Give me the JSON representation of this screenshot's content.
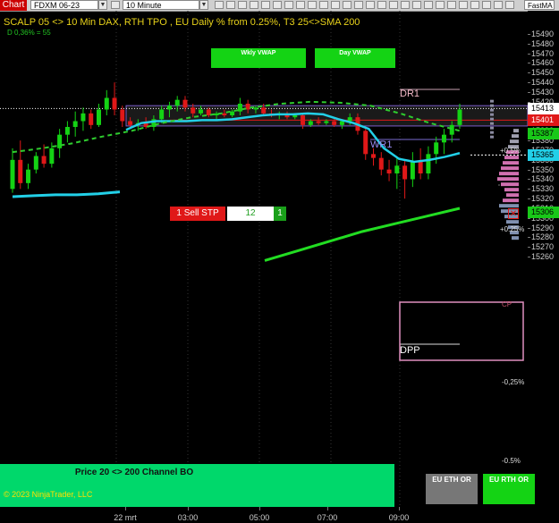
{
  "toolbar": {
    "chart_label": "Chart",
    "instrument": "FDXM 06-23",
    "interval": "10 Minute",
    "fast_ma": "FastMA",
    "highlight": "6 VWAP"
  },
  "chart_title": "SCALP 05 <> 10 Min DAX, RTH TPO , EU Daily % from 0.25%, T3 25<>SMA 200",
  "subtitle": "D 0,36% = 55",
  "buttons": {
    "wkly_vwap": "Wkly VWAP",
    "day_vwap": "Day VWAP",
    "eu_eth_or": "EU ETH OR",
    "eu_rth_or": "EU RTH OR"
  },
  "levels": {
    "dr1": "DR1",
    "wr1": "WR1",
    "dpp": "DPP",
    "cp": "CP"
  },
  "percent_labels": {
    "p1": "+0.5%",
    "p2": "+0.25%",
    "m1": "-0,25%",
    "m2": "-0.5%"
  },
  "order": {
    "label": "1 Sell STP",
    "quantity": "12",
    "size": "1"
  },
  "price_axis": {
    "ticks": [
      "15490",
      "15480",
      "15470",
      "15460",
      "15450",
      "15440",
      "15430",
      "15420",
      "15410",
      "15400",
      "15390",
      "15380",
      "15370",
      "15360",
      "15350",
      "15340",
      "15330",
      "15320",
      "15310",
      "15300",
      "15290",
      "15280",
      "15270",
      "15260"
    ],
    "tags": [
      {
        "value": "15413",
        "bg": "#ffffff",
        "fg": "#000000"
      },
      {
        "value": "15401",
        "bg": "#e01818",
        "fg": "#ffffff"
      },
      {
        "value": "15387",
        "bg": "#18c818",
        "fg": "#000000"
      },
      {
        "value": "15365",
        "bg": "#22d0e8",
        "fg": "#000000"
      },
      {
        "value": "15306",
        "bg": "#18c818",
        "fg": "#000000"
      }
    ]
  },
  "time_axis": [
    "22 mrt",
    "03:00",
    "05:00",
    "07:00",
    "09:00"
  ],
  "banner": {
    "title": "Price 20 <> 200 Channel BO",
    "copyright": "© 2023 NinjaTrader, LLC"
  },
  "colors": {
    "up_candle": "#14d314",
    "down_candle": "#e01818",
    "vwap_line": "#22d0e8",
    "sma_line": "#2ecc2e",
    "banner": "#00d86b"
  },
  "candles": [
    {
      "o": 15330,
      "h": 15372,
      "l": 15326,
      "c": 15360
    },
    {
      "o": 15360,
      "h": 15380,
      "l": 15330,
      "c": 15336
    },
    {
      "o": 15336,
      "h": 15356,
      "l": 15330,
      "c": 15350
    },
    {
      "o": 15350,
      "h": 15368,
      "l": 15346,
      "c": 15364
    },
    {
      "o": 15364,
      "h": 15376,
      "l": 15352,
      "c": 15356
    },
    {
      "o": 15356,
      "h": 15378,
      "l": 15352,
      "c": 15372
    },
    {
      "o": 15372,
      "h": 15392,
      "l": 15362,
      "c": 15386
    },
    {
      "o": 15386,
      "h": 15400,
      "l": 15378,
      "c": 15394
    },
    {
      "o": 15394,
      "h": 15410,
      "l": 15384,
      "c": 15400
    },
    {
      "o": 15400,
      "h": 15414,
      "l": 15390,
      "c": 15408
    },
    {
      "o": 15408,
      "h": 15412,
      "l": 15392,
      "c": 15396
    },
    {
      "o": 15396,
      "h": 15418,
      "l": 15394,
      "c": 15412
    },
    {
      "o": 15412,
      "h": 15432,
      "l": 15406,
      "c": 15424
    },
    {
      "o": 15424,
      "h": 15440,
      "l": 15406,
      "c": 15412
    },
    {
      "o": 15412,
      "h": 15416,
      "l": 15394,
      "c": 15400
    },
    {
      "o": 15400,
      "h": 15404,
      "l": 15392,
      "c": 15396
    },
    {
      "o": 15396,
      "h": 15402,
      "l": 15390,
      "c": 15398
    },
    {
      "o": 15398,
      "h": 15404,
      "l": 15392,
      "c": 15394
    },
    {
      "o": 15394,
      "h": 15406,
      "l": 15390,
      "c": 15402
    },
    {
      "o": 15402,
      "h": 15416,
      "l": 15398,
      "c": 15412
    },
    {
      "o": 15412,
      "h": 15420,
      "l": 15404,
      "c": 15416
    },
    {
      "o": 15416,
      "h": 15426,
      "l": 15410,
      "c": 15422
    },
    {
      "o": 15422,
      "h": 15426,
      "l": 15410,
      "c": 15414
    },
    {
      "o": 15414,
      "h": 15418,
      "l": 15404,
      "c": 15408
    },
    {
      "o": 15408,
      "h": 15416,
      "l": 15406,
      "c": 15412
    },
    {
      "o": 15412,
      "h": 15414,
      "l": 15404,
      "c": 15406
    },
    {
      "o": 15406,
      "h": 15410,
      "l": 15402,
      "c": 15408
    },
    {
      "o": 15408,
      "h": 15412,
      "l": 15404,
      "c": 15406
    },
    {
      "o": 15406,
      "h": 15412,
      "l": 15404,
      "c": 15410
    },
    {
      "o": 15410,
      "h": 15424,
      "l": 15406,
      "c": 15418
    },
    {
      "o": 15418,
      "h": 15422,
      "l": 15408,
      "c": 15412
    },
    {
      "o": 15412,
      "h": 15416,
      "l": 15408,
      "c": 15414
    },
    {
      "o": 15414,
      "h": 15418,
      "l": 15406,
      "c": 15408
    },
    {
      "o": 15408,
      "h": 15412,
      "l": 15404,
      "c": 15406
    },
    {
      "o": 15406,
      "h": 15410,
      "l": 15402,
      "c": 15408
    },
    {
      "o": 15408,
      "h": 15410,
      "l": 15402,
      "c": 15404
    },
    {
      "o": 15404,
      "h": 15408,
      "l": 15402,
      "c": 15406
    },
    {
      "o": 15406,
      "h": 15408,
      "l": 15392,
      "c": 15396
    },
    {
      "o": 15396,
      "h": 15402,
      "l": 15394,
      "c": 15400
    },
    {
      "o": 15400,
      "h": 15404,
      "l": 15396,
      "c": 15398
    },
    {
      "o": 15398,
      "h": 15402,
      "l": 15396,
      "c": 15400
    },
    {
      "o": 15400,
      "h": 15404,
      "l": 15394,
      "c": 15396
    },
    {
      "o": 15396,
      "h": 15402,
      "l": 15392,
      "c": 15400
    },
    {
      "o": 15400,
      "h": 15408,
      "l": 15396,
      "c": 15404
    },
    {
      "o": 15404,
      "h": 15408,
      "l": 15386,
      "c": 15390
    },
    {
      "o": 15390,
      "h": 15394,
      "l": 15360,
      "c": 15366
    },
    {
      "o": 15366,
      "h": 15372,
      "l": 15354,
      "c": 15362
    },
    {
      "o": 15362,
      "h": 15368,
      "l": 15344,
      "c": 15350
    },
    {
      "o": 15350,
      "h": 15360,
      "l": 15338,
      "c": 15346
    },
    {
      "o": 15346,
      "h": 15362,
      "l": 15330,
      "c": 15354
    },
    {
      "o": 15354,
      "h": 15360,
      "l": 15320,
      "c": 15340
    },
    {
      "o": 15340,
      "h": 15368,
      "l": 15332,
      "c": 15358
    },
    {
      "o": 15358,
      "h": 15372,
      "l": 15340,
      "c": 15346
    },
    {
      "o": 15346,
      "h": 15374,
      "l": 15340,
      "c": 15366
    },
    {
      "o": 15366,
      "h": 15384,
      "l": 15356,
      "c": 15378
    },
    {
      "o": 15378,
      "h": 15392,
      "l": 15366,
      "c": 15386
    },
    {
      "o": 15386,
      "h": 15400,
      "l": 15378,
      "c": 15396
    },
    {
      "o": 15396,
      "h": 15418,
      "l": 15392,
      "c": 15412
    }
  ],
  "vwap": [
    15391,
    15398,
    15400,
    15400,
    15400,
    15401,
    15401,
    15402,
    15404,
    15406,
    15407,
    15407,
    15408,
    15407,
    15402,
    15398,
    15392,
    15372,
    15361,
    15358,
    15360,
    15363,
    15367
  ],
  "sma": [
    15368,
    15372,
    15377,
    15384,
    15390,
    15398,
    15404,
    15408,
    15414,
    15418,
    15420,
    15419,
    15416,
    15408,
    15398,
    15390
  ],
  "upper_trend": [
    15322,
    15323,
    15324,
    15324,
    15325,
    15327
  ],
  "lower_trend": [
    15256,
    15266,
    15276,
    15286,
    15294,
    15302,
    15310
  ]
}
